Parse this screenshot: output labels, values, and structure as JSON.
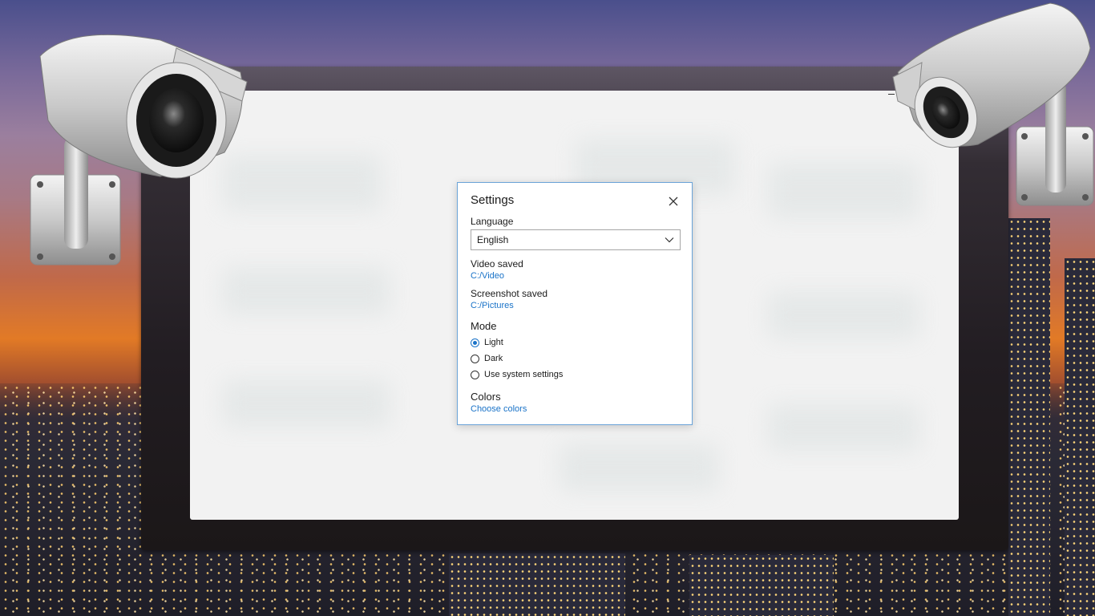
{
  "dialog": {
    "title": "Settings",
    "close_icon": "close-icon",
    "language": {
      "label": "Language",
      "selected": "English",
      "dropdown_icon": "chevron-down-icon"
    },
    "video": {
      "label": "Video saved",
      "path": "C:/Video"
    },
    "screenshot": {
      "label": "Screenshot saved",
      "path": "C:/Pictures"
    },
    "mode": {
      "label": "Mode",
      "options": [
        {
          "label": "Light",
          "selected": true
        },
        {
          "label": "Dark",
          "selected": false
        },
        {
          "label": "Use system settings",
          "selected": false
        }
      ]
    },
    "colors": {
      "label": "Colors",
      "link": "Choose colors"
    }
  },
  "theme": {
    "accent": "#1a73c8",
    "dialog_border": "#6aa3d8",
    "text": "#1b1b1b"
  }
}
